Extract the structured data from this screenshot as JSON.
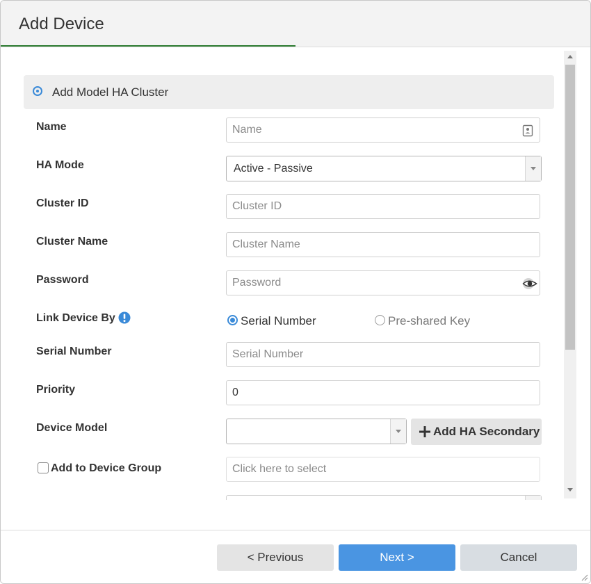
{
  "dialog": {
    "title": "Add Device"
  },
  "section": {
    "title": "Add Model HA Cluster"
  },
  "form": {
    "name": {
      "label": "Name",
      "placeholder": "Name"
    },
    "ha_mode": {
      "label": "HA Mode",
      "value": "Active - Passive"
    },
    "cluster_id": {
      "label": "Cluster ID",
      "placeholder": "Cluster ID"
    },
    "cluster_name": {
      "label": "Cluster Name",
      "placeholder": "Cluster Name"
    },
    "password": {
      "label": "Password",
      "placeholder": "Password"
    },
    "link_device_by": {
      "label": "Link Device By",
      "options": [
        "Serial Number",
        "Pre-shared Key"
      ],
      "selected": "Serial Number"
    },
    "serial_number": {
      "label": "Serial Number",
      "placeholder": "Serial Number"
    },
    "priority": {
      "label": "Priority",
      "value": "0"
    },
    "device_model": {
      "label": "Device Model",
      "value": ""
    },
    "add_ha_secondary": {
      "label": "Add HA Secondary"
    },
    "add_to_device_group": {
      "label": "Add to Device Group",
      "checked": false,
      "placeholder": "Click here to select"
    }
  },
  "footer": {
    "previous_label": "< Previous",
    "next_label": "Next >",
    "cancel_label": "Cancel"
  },
  "colors": {
    "accent": "#3a8ad8",
    "progress": "#2e7d32",
    "next_button": "#4a95e2"
  },
  "icons": [
    "contact-card-icon",
    "eye-icon",
    "info-icon",
    "plus-icon",
    "chevron-down-icon",
    "resize-grip-icon"
  ]
}
